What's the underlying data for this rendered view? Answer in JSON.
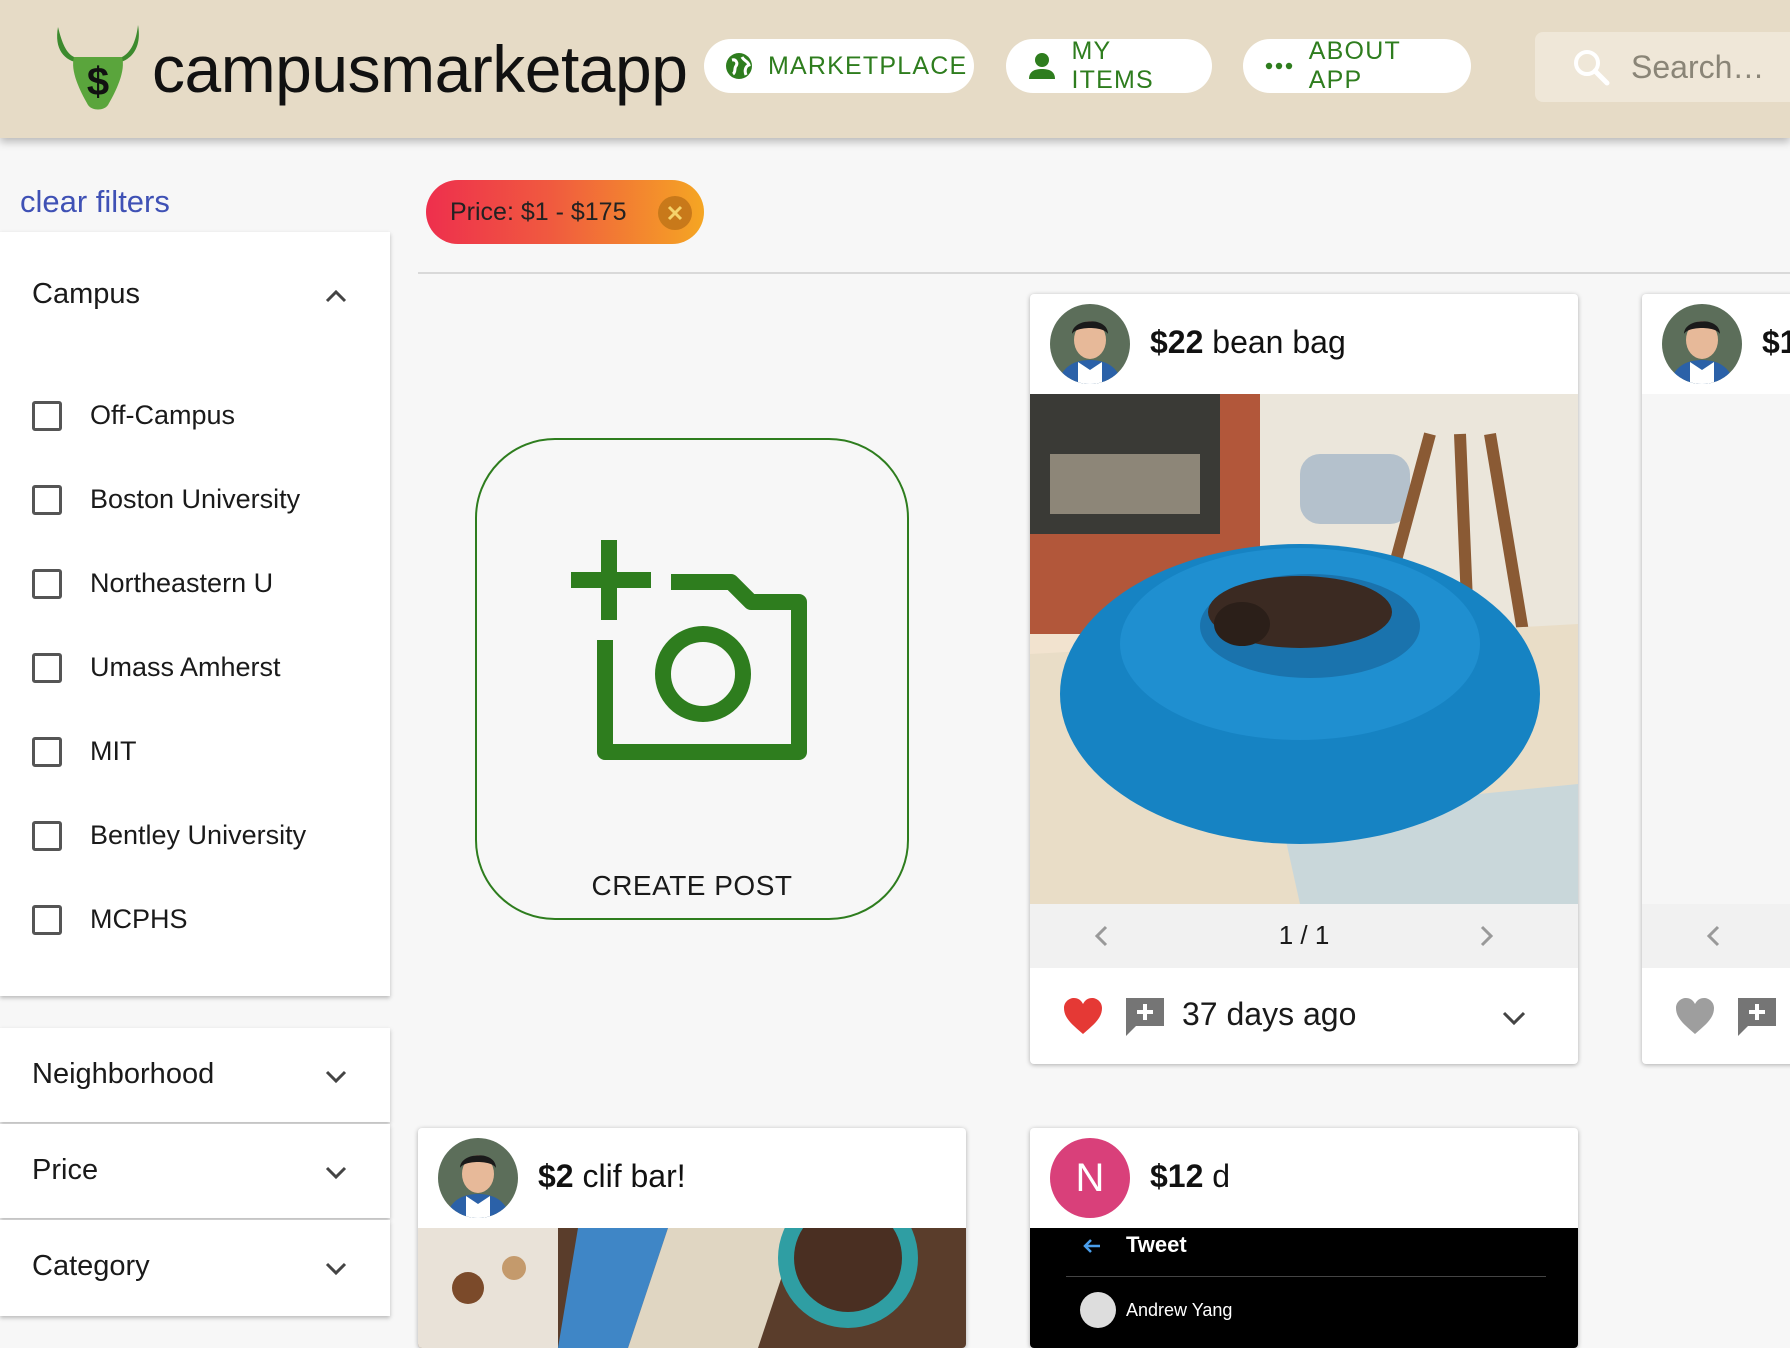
{
  "brand": {
    "name": "campusmarketapp",
    "logo_symbol": "$",
    "accent": "#2e7d1e"
  },
  "nav": {
    "marketplace": "MARKETPLACE",
    "my_items": "MY ITEMS",
    "about": "ABOUT APP"
  },
  "search": {
    "placeholder": "Search…"
  },
  "sidebar": {
    "clear_filters": "clear filters",
    "campus": {
      "title": "Campus",
      "options": [
        "Off-Campus",
        "Boston University",
        "Northeastern U",
        "Umass Amherst",
        "MIT",
        "Bentley University",
        "MCPHS"
      ]
    },
    "neighborhood": "Neighborhood",
    "price": "Price",
    "category": "Category"
  },
  "active_filter": {
    "label": "Price: $1 - $175"
  },
  "create_post": {
    "label": "CREATE POST"
  },
  "listings": [
    {
      "price": "$22",
      "title": "bean bag",
      "pager": "1 / 1",
      "age": "37 days ago",
      "liked": true
    },
    {
      "price": "$1",
      "title": "",
      "liked": false
    },
    {
      "price": "$2",
      "title": "clif bar!"
    },
    {
      "price": "$12",
      "title": "d",
      "avatar_letter": "N",
      "tweet_header": "Tweet",
      "tweet_user": "Andrew Yang"
    }
  ]
}
